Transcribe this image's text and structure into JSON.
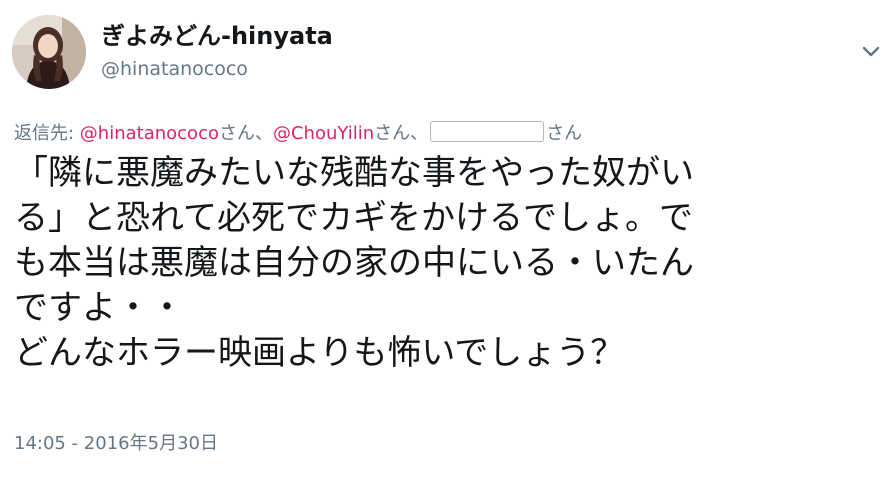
{
  "user": {
    "display_name": "ぎよみどん-hinyata",
    "handle": "@hinatanococo",
    "avatar_icon": "profile-photo"
  },
  "menu": {
    "icon": "chevron-down-icon"
  },
  "reply": {
    "prefix": "返信先: ",
    "mentions": [
      {
        "name": "@hinatanococo",
        "suffix": "さん、"
      },
      {
        "name": "@ChouYilin",
        "suffix": "さん、"
      }
    ],
    "redacted_suffix": "さん"
  },
  "tweet": {
    "lines": [
      "「隣に悪魔みたいな残酷な事をやった奴がい",
      "る」と恐れて必死でカギをかけるでしょ。で",
      "も本当は悪魔は自分の家の中にいる・いたん",
      "ですよ・・",
      "どんなホラー映画よりも怖いでしょう？"
    ]
  },
  "timestamp": "14:05 - 2016年5月30日",
  "colors": {
    "mention": "#e0245e",
    "secondary_text": "#657786",
    "primary_text": "#14171a"
  }
}
